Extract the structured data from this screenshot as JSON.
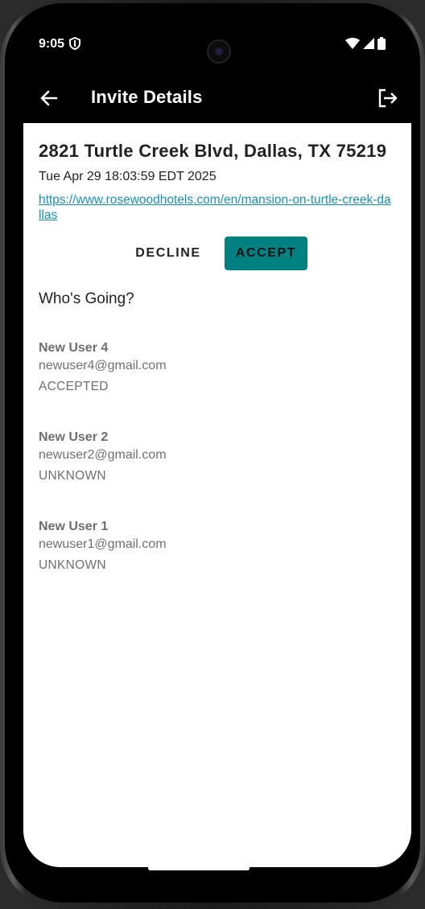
{
  "status_bar": {
    "time": "9:05",
    "icons": [
      "shield-icon",
      "wifi-icon",
      "signal-icon",
      "battery-icon"
    ]
  },
  "app_bar": {
    "title": "Invite Details",
    "back_icon": "back-arrow-icon",
    "exit_icon": "logout-icon"
  },
  "invite": {
    "address": "2821 Turtle Creek Blvd, Dallas, TX 75219",
    "datetime": "Tue Apr 29 18:03:59 EDT 2025",
    "link": "https://www.rosewoodhotels.com/en/mansion-on-turtle-creek-dallas"
  },
  "actions": {
    "decline_label": "DECLINE",
    "accept_label": "ACCEPT"
  },
  "attendees": {
    "title": "Who's Going?",
    "list": [
      {
        "name": "New User 4",
        "email": "newuser4@gmail.com",
        "status": "ACCEPTED"
      },
      {
        "name": "New User 2",
        "email": "newuser2@gmail.com",
        "status": "UNKNOWN"
      },
      {
        "name": "New User 1",
        "email": "newuser1@gmail.com",
        "status": "UNKNOWN"
      }
    ]
  },
  "colors": {
    "accent": "#008080",
    "link": "#1a8fb5",
    "app_bar": "#000000"
  }
}
